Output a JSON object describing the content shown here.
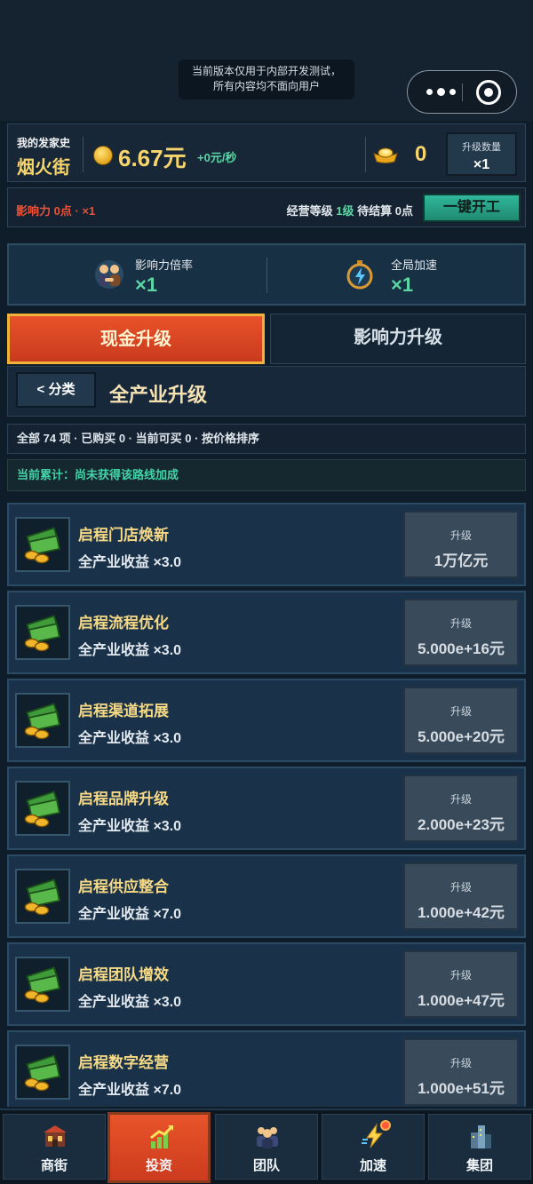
{
  "notice": {
    "line1": "当前版本仅用于内部开发测试，",
    "line2": "所有内容均不面向用户"
  },
  "capsule": {
    "more_icon": "more-dots-icon",
    "close_icon": "mini-program-close-icon"
  },
  "header": {
    "history_label": "我的发家史",
    "street_name": "烟火街",
    "money": "6.67元",
    "rate": "+0元/秒",
    "ingot_count": "0",
    "upgrade_qty_label": "升级数量",
    "upgrade_qty_value": "×1"
  },
  "status": {
    "influence": "影响力 0点 · ×1",
    "level_label": "经营等级",
    "level_value": "1级",
    "pending_label": "待结算 0点",
    "onekey_button": "一键开工"
  },
  "boosts": {
    "influence_rate_label": "影响力倍率",
    "influence_rate_value": "×1",
    "global_speed_label": "全局加速",
    "global_speed_value": "×1"
  },
  "tabs": {
    "cash": "现金升级",
    "influence": "影响力升级"
  },
  "category": {
    "back_button": "< 分类",
    "title": "全产业升级"
  },
  "summary": "全部 74 项 · 已购买 0 · 当前可买 0 · 按价格排序",
  "accumulated": "当前累计：尚未获得该路线加成",
  "upgrade_label": "升级",
  "items": [
    {
      "name": "启程门店焕新",
      "effect": "全产业收益 ×3.0",
      "price": "1万亿元"
    },
    {
      "name": "启程流程优化",
      "effect": "全产业收益 ×3.0",
      "price": "5.000e+16元"
    },
    {
      "name": "启程渠道拓展",
      "effect": "全产业收益 ×3.0",
      "price": "5.000e+20元"
    },
    {
      "name": "启程品牌升级",
      "effect": "全产业收益 ×3.0",
      "price": "2.000e+23元"
    },
    {
      "name": "启程供应整合",
      "effect": "全产业收益 ×7.0",
      "price": "1.000e+42元"
    },
    {
      "name": "启程团队增效",
      "effect": "全产业收益 ×3.0",
      "price": "1.000e+47元"
    },
    {
      "name": "启程数字经营",
      "effect": "全产业收益 ×7.0",
      "price": "1.000e+51元"
    }
  ],
  "nav": [
    {
      "label": "商街",
      "icon": "shop-street-icon"
    },
    {
      "label": "投资",
      "icon": "invest-chart-icon"
    },
    {
      "label": "团队",
      "icon": "team-icon"
    },
    {
      "label": "加速",
      "icon": "speed-up-icon"
    },
    {
      "label": "集团",
      "icon": "group-buildings-icon"
    }
  ],
  "colors": {
    "gold": "#f7d56b",
    "green": "#5bd6a4",
    "accent_red": "#e8522a",
    "bg": "#0f1d2b"
  }
}
